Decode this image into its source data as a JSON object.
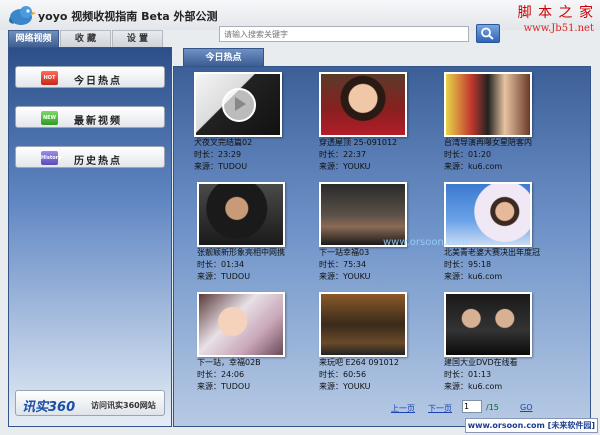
{
  "app": {
    "title": "yoyo 视频收视指南 Beta 外部公测"
  },
  "watermark": {
    "line1": "脚 本 之 家",
    "line2": "www.Jb51.net",
    "bottom": "www.orsoon.com [未来软件园]",
    "overlay": "www.orsoon.com"
  },
  "tabs": [
    {
      "label": "网络视频"
    },
    {
      "label": "收 藏"
    },
    {
      "label": "设 置"
    }
  ],
  "search": {
    "placeholder": "请输入搜索关键字"
  },
  "sidebar": {
    "items": [
      {
        "label": "今日热点",
        "icon": "hot-icon",
        "badge": "HOT"
      },
      {
        "label": "最新视频",
        "icon": "new-icon",
        "badge": "NEW"
      },
      {
        "label": "历史热点",
        "icon": "history-icon",
        "badge": "History"
      }
    ],
    "promo": {
      "logo": "讯实360",
      "text": "访问讯实360网站"
    }
  },
  "main": {
    "tab": "今日热点",
    "videos": [
      {
        "title": "犬夜叉完结篇02",
        "duration": "时长：23:29",
        "source": "来源：TUDOU"
      },
      {
        "title": "穿透屋顶 25-091012",
        "duration": "时长：22:37",
        "source": "来源：YOUKU"
      },
      {
        "title": "台湾导演再曝女星陪客内",
        "duration": "时长：01:20",
        "source": "来源：ku6.com"
      },
      {
        "title": "张靓颖新形象亮相中网携",
        "duration": "时长：01:34",
        "source": "来源：TUDOU"
      },
      {
        "title": "下一站幸福03",
        "duration": "时长：75:34",
        "source": "来源：YOUKU"
      },
      {
        "title": "北美青老婆大赛决出年度冠",
        "duration": "时长：95:18",
        "source": "来源：ku6.com"
      },
      {
        "title": "下一站，幸福02B",
        "duration": "时长：24:06",
        "source": "来源：TUDOU"
      },
      {
        "title": "来玩吧 E264 091012",
        "duration": "时长：60:56",
        "source": "来源：YOUKU"
      },
      {
        "title": "建国大业DVD在线看",
        "duration": "时长：01:13",
        "source": "来源：ku6.com"
      }
    ],
    "pager": {
      "prev": "上一页",
      "next": "下一页",
      "current": "1",
      "total": "/15",
      "go": "GO"
    }
  }
}
